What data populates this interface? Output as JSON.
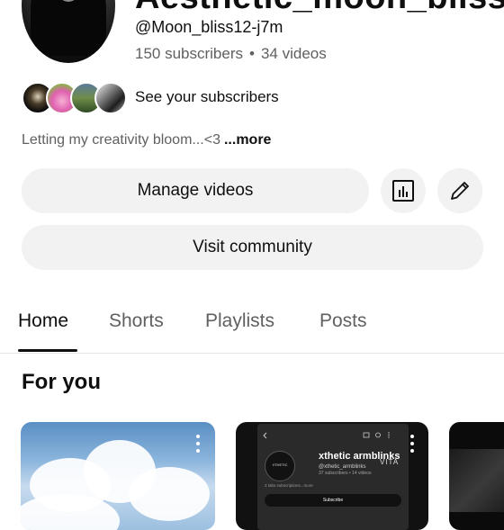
{
  "channel": {
    "name": "Aesthetic_moon_bliss",
    "handle": "@Moon_bliss12-j7m",
    "subscribers": "150 subscribers",
    "separator": "•",
    "videos": "34 videos",
    "see_subscribers": "See your subscribers",
    "description": "Letting my creativity bloom...<3",
    "more": "...more"
  },
  "actions": {
    "manage_videos": "Manage videos",
    "visit_community": "Visit community",
    "analytics_icon": "analytics-icon",
    "edit_icon": "pencil-icon"
  },
  "tabs": [
    {
      "label": "Home",
      "active": true
    },
    {
      "label": "Shorts",
      "active": false
    },
    {
      "label": "Playlists",
      "active": false
    },
    {
      "label": "Posts",
      "active": false
    }
  ],
  "section": {
    "title": "For you"
  },
  "shorts": [
    {
      "thumbnail": "sky-clouds"
    },
    {
      "thumbnail": "channel-screenshot",
      "inner_title": "xthetic armblinks",
      "inner_handle": "@xthetic_armblinks",
      "inner_stats": "37 subscribers • 14 videos",
      "inner_desc": "2 tabs subscriptions...more",
      "inner_subscribe": "Subscribe",
      "watermark": "VITA",
      "avatar_text": "XTHETIC"
    },
    {
      "thumbnail": "dark-clip"
    }
  ],
  "colors": {
    "text_primary": "#0f0f0f",
    "text_secondary": "#606060",
    "pill_bg": "#f2f2f2",
    "divider": "#e5e5e5"
  }
}
